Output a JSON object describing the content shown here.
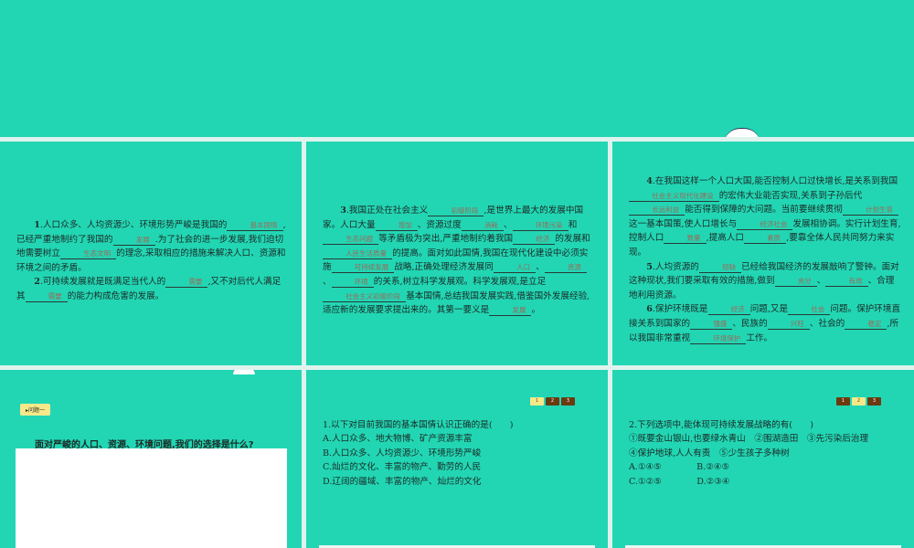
{
  "slide1": {
    "paras": [
      [
        {
          "t": "1",
          "bold": true
        },
        {
          "t": ".人口众多、人均资源少、环境形势严峻是我国的"
        },
        {
          "b": "基本国情"
        },
        {
          "t": ",已经严重地制约了我国的"
        },
        {
          "b": "发展"
        },
        {
          "t": ".为了社会的进一步发展,我们迫切地需要树立"
        },
        {
          "b": "生态文明"
        },
        {
          "t": "的理念,采取相应的措施来解决人口、资源和环境之间的矛盾。"
        }
      ],
      [
        {
          "t": "2",
          "bold": true
        },
        {
          "t": ".可持续发展就是既满足当代人的"
        },
        {
          "b": "需要"
        },
        {
          "t": ",又不对后代人满足其"
        },
        {
          "b": "需要"
        },
        {
          "t": "的能力构成危害的发展。"
        }
      ]
    ]
  },
  "slide2": {
    "paras": [
      [
        {
          "t": "3",
          "bold": true
        },
        {
          "t": ".我国正处在社会主义"
        },
        {
          "b": "初级阶段"
        },
        {
          "t": ",是世界上最大的发展中国家。人口大量"
        },
        {
          "b": "增加"
        },
        {
          "t": "、资源过度"
        },
        {
          "b": "消耗"
        },
        {
          "t": "、"
        },
        {
          "b": "环境污染"
        },
        {
          "t": "和"
        },
        {
          "b": "生态问题"
        },
        {
          "t": "等矛盾极为突出,严重地制约着我国"
        },
        {
          "b": "经济"
        },
        {
          "t": "的发展和"
        },
        {
          "b": "人民生活质量"
        },
        {
          "t": "的提高。面对如此国情,我国在现代化建设中必须实施"
        },
        {
          "b": "可持续发展"
        },
        {
          "t": "战略,正确处理经济发展同"
        },
        {
          "b": "人口"
        },
        {
          "t": "、"
        },
        {
          "b": "资源"
        },
        {
          "t": "、"
        },
        {
          "b": "环境"
        },
        {
          "t": "的关系,树立科学发展观。科学发展观,是立足"
        },
        {
          "b": "社会主义初级阶段"
        },
        {
          "t": "基本国情,总结我国发展实践,借鉴国外发展经验,适应新的发展要求提出来的。其第一要义是"
        },
        {
          "b": "发展"
        },
        {
          "t": "。"
        }
      ]
    ]
  },
  "slide3": {
    "paras": [
      [
        {
          "t": "4",
          "bold": true
        },
        {
          "t": ".在我国这样一个人口大国,能否控制人口过快增长,是关系到我国"
        },
        {
          "b": "社会主义现代化建设"
        },
        {
          "t": "的宏伟大业能否实现,关系到子孙后代"
        },
        {
          "b": "长远利益"
        },
        {
          "t": "能否得到保障的大问题。当前要继续贯彻"
        },
        {
          "b": "计划生育"
        },
        {
          "t": "这一基本国策,使人口增长与"
        },
        {
          "b": "经济社会"
        },
        {
          "t": "发展相协调。实行计划生育,控制人口"
        },
        {
          "b": "数量"
        },
        {
          "t": ",提高人口"
        },
        {
          "b": "素质"
        },
        {
          "t": ",要靠全体人民共同努力来实现。"
        }
      ],
      [
        {
          "t": "5",
          "bold": true
        },
        {
          "t": ".人均资源的"
        },
        {
          "b": "短缺"
        },
        {
          "t": "已经给我国经济的发展敲响了警钟。面对这种现状,我们要采取有效的措施,做到"
        },
        {
          "b": "充分"
        },
        {
          "t": "、"
        },
        {
          "b": "有效"
        },
        {
          "t": "、合理地利用资源。"
        }
      ],
      [
        {
          "t": "6",
          "bold": true
        },
        {
          "t": ".保护环境既是"
        },
        {
          "b": "经济"
        },
        {
          "t": "问题,又是"
        },
        {
          "b": "社会"
        },
        {
          "t": "问题。保护环境直接关系到国家的"
        },
        {
          "b": "强盛"
        },
        {
          "t": "、民族的"
        },
        {
          "b": "兴旺"
        },
        {
          "t": "、社会的"
        },
        {
          "b": "稳定"
        },
        {
          "t": ",所以我国非常重视"
        },
        {
          "b": "环境保护"
        },
        {
          "t": "工作。"
        }
      ]
    ]
  },
  "slide4": {
    "tag": "▸问题一",
    "question": "面对严峻的人口、资源、环境问题,我们的选择是什么?"
  },
  "slide5": {
    "pager": [
      "1",
      "2",
      "3"
    ],
    "active": 0,
    "lines": [
      "1.以下对目前我国的基本国情认识正确的是(　　)",
      "A.人口众多、地大物博、矿产资源丰富",
      "B.人口众多、人均资源少、环境形势严峻",
      "C.灿烂的文化、丰富的物产、勤劳的人民",
      "D.辽阔的疆域、丰富的物产、灿烂的文化"
    ]
  },
  "slide6": {
    "pager": [
      "1",
      "2",
      "3"
    ],
    "active": 1,
    "lines": [
      "2.下列选项中,能体现可持续发展战略的有(　　)",
      "①既要金山银山,也要绿水青山　②围湖造田　③先污染后治理",
      "④保护地球,人人有责　⑤少生孩子多种树",
      "A.①④⑤　　　　B.②④⑤",
      "C.①②⑤　　　　D.②③④"
    ]
  },
  "colors": {
    "background": "#22d6b4",
    "answer": "#9a6a58",
    "pager_active": "#f7e98a",
    "pager": "#6b3a10"
  }
}
